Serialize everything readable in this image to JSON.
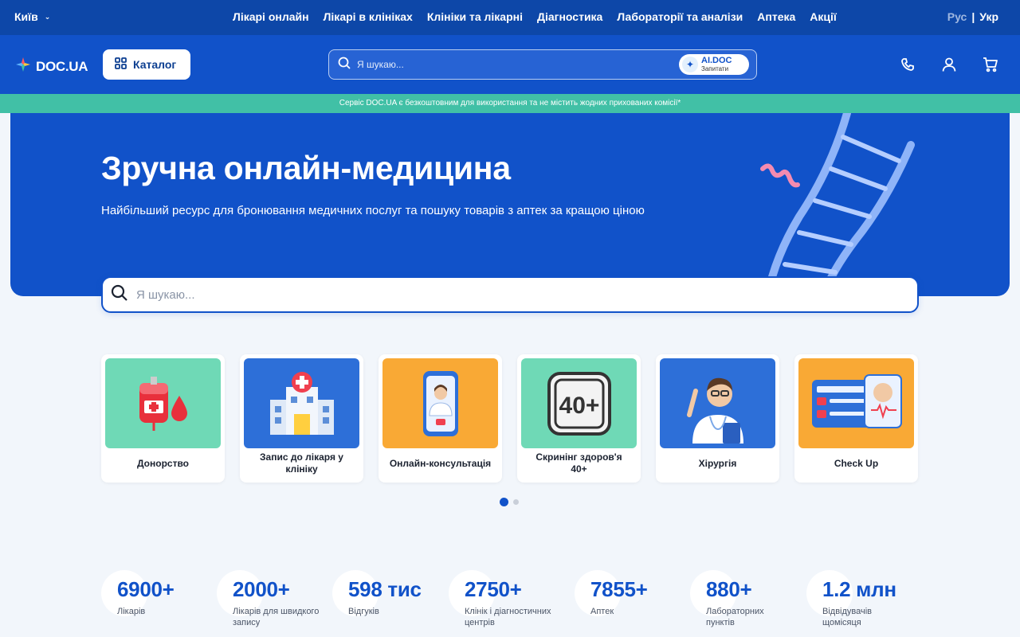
{
  "topbar": {
    "city": "Київ",
    "nav": [
      "Лікарі онлайн",
      "Лікарі в клініках",
      "Клініки та лікарні",
      "Діагностика",
      "Лабораторії та аналізи",
      "Аптека",
      "Акції"
    ],
    "lang_ru": "Рус",
    "lang_sep": "|",
    "lang_uk": "Укр"
  },
  "header": {
    "logo": "DOC.UA",
    "catalog": "Каталог",
    "search_placeholder": "Я шукаю...",
    "aidoc_title": "AI.DOC",
    "aidoc_sub": "Запитати",
    "icons": [
      "phone-icon",
      "user-icon",
      "cart-icon"
    ]
  },
  "notice": "Сервіс DOC.UA є безкоштовним для використання та не містить жодних прихованих комісії*",
  "hero": {
    "title": "Зручна онлайн-медицина",
    "subtitle": "Найбільший ресурс для бронювання медичних послуг та пошуку товарів з аптек за кращою ціною",
    "search_placeholder": "Я шукаю..."
  },
  "cards": [
    {
      "label": "Донорство",
      "bg": "#6fd9b6",
      "icon": "blood-bag-icon"
    },
    {
      "label": "Запис до лікаря у клініку",
      "bg": "#2d6fd8",
      "icon": "hospital-icon"
    },
    {
      "label": "Онлайн-консультація",
      "bg": "#f9a935",
      "icon": "phone-doctor-icon"
    },
    {
      "label": "Скринінг здоров'я 40+",
      "bg": "#6fd9b6",
      "icon": "forty-plus-icon"
    },
    {
      "label": "Хірургія",
      "bg": "#2d6fd8",
      "icon": "doctor-icon"
    },
    {
      "label": "Check Up",
      "bg": "#f9a935",
      "icon": "medical-card-icon"
    }
  ],
  "carousel": {
    "pages": 2,
    "active": 0
  },
  "stats": [
    {
      "num": "6900+",
      "cap": "Лікарів"
    },
    {
      "num": "2000+",
      "cap": "Лікарів для швидкого запису"
    },
    {
      "num": "598 тис",
      "cap": "Відгуків"
    },
    {
      "num": "2750+",
      "cap": "Клінік і діагностичних центрів"
    },
    {
      "num": "7855+",
      "cap": "Аптек"
    },
    {
      "num": "880+",
      "cap": "Лабораторних пунктів"
    },
    {
      "num": "1.2 млн",
      "cap": "Відвідувачів щомісяця"
    }
  ],
  "colors": {
    "primary": "#1152c9",
    "topbar": "#0d47a8",
    "notice": "#41c0a6"
  }
}
